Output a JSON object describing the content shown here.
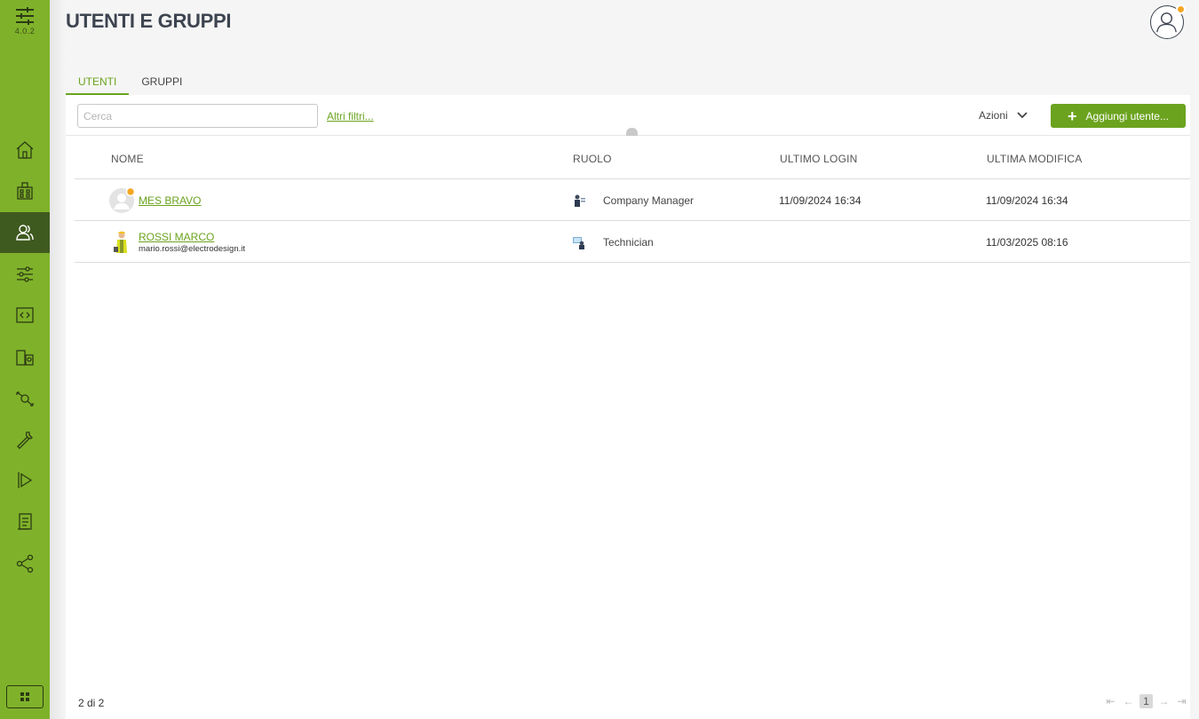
{
  "app": {
    "version": "4.0.2"
  },
  "header": {
    "title": "UTENTI E GRUPPI"
  },
  "tabs": [
    {
      "label": "UTENTI",
      "active": true
    },
    {
      "label": "GRUPPI",
      "active": false
    }
  ],
  "toolbar": {
    "search_placeholder": "Cerca",
    "filters_label": "Altri filtri...",
    "actions_label": "Azioni",
    "add_button_label": "Aggiungi utente..."
  },
  "table": {
    "headers": [
      "NOME",
      "RUOLO",
      "ULTIMO LOGIN",
      "ULTIMA MODIFICA"
    ],
    "rows": [
      {
        "name": "MES BRAVO",
        "email": "",
        "role": "Company Manager",
        "last_login": "11/09/2024 16:34",
        "last_modified": "11/09/2024 16:34"
      },
      {
        "name": "ROSSI MARCO",
        "email": "mario.rossi@electrodesign.it",
        "role": "Technician",
        "last_login": "",
        "last_modified": "11/03/2025 08:16"
      }
    ]
  },
  "footer": {
    "count": "2 di 2",
    "current_page": "1"
  },
  "colors": {
    "accent": "#7fb22a",
    "accent_dark": "#6ba31f",
    "sidebar_active": "#3f5a1f",
    "badge": "#f5a623"
  },
  "sidebar": {
    "items": [
      {
        "icon": "home-icon"
      },
      {
        "icon": "building-icon"
      },
      {
        "icon": "users-icon",
        "active": true
      },
      {
        "icon": "sliders-icon"
      },
      {
        "icon": "code-panel-icon"
      },
      {
        "icon": "devices-icon"
      },
      {
        "icon": "flow-icon"
      },
      {
        "icon": "wrench-icon"
      },
      {
        "icon": "play-flag-icon"
      },
      {
        "icon": "report-icon"
      },
      {
        "icon": "share-icon"
      }
    ]
  }
}
